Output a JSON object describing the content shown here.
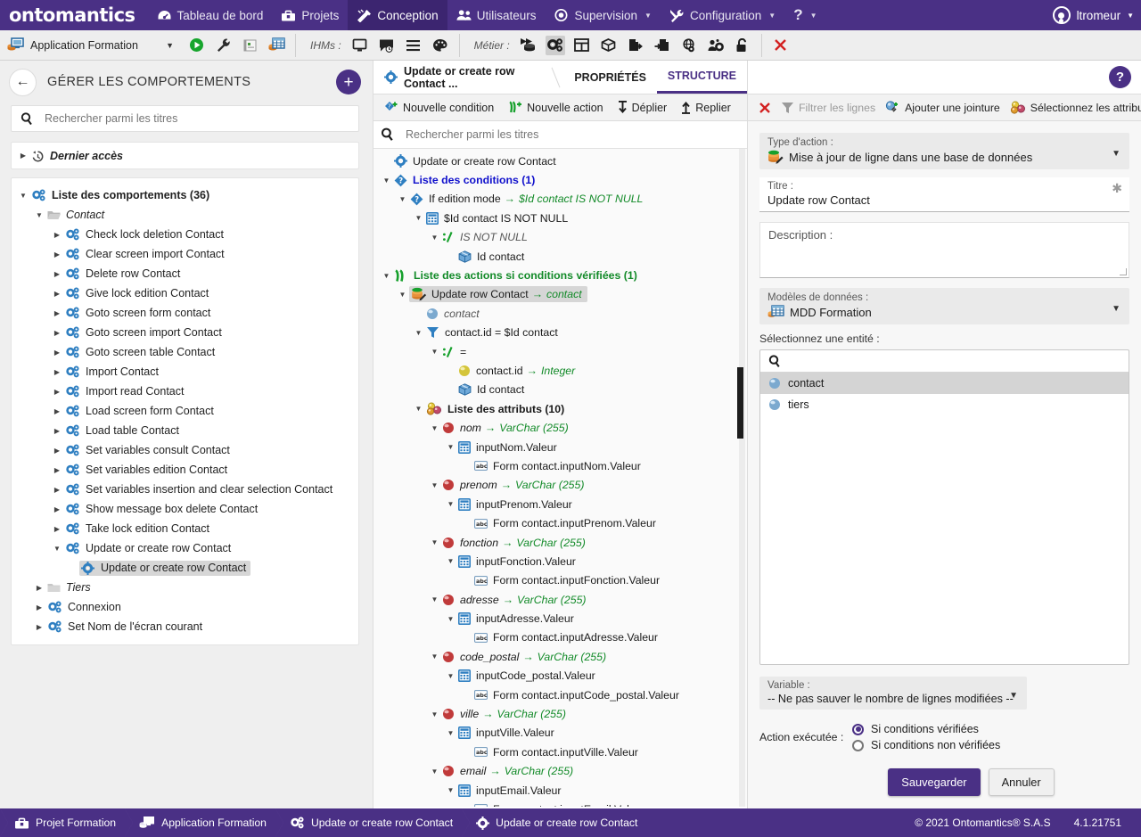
{
  "topnav": {
    "brand": "ontomantics",
    "items": [
      {
        "label": "Tableau de bord",
        "icon": "dashboard-icon",
        "caret": false,
        "active": false
      },
      {
        "label": "Projets",
        "icon": "toolbox-icon",
        "caret": false,
        "active": false
      },
      {
        "label": "Conception",
        "icon": "design-icon",
        "caret": false,
        "active": true
      },
      {
        "label": "Utilisateurs",
        "icon": "users-icon",
        "caret": false,
        "active": false
      },
      {
        "label": "Supervision",
        "icon": "eye-icon",
        "caret": true,
        "active": false
      },
      {
        "label": "Configuration",
        "icon": "tools-icon",
        "caret": true,
        "active": false
      },
      {
        "label": "?",
        "icon": "help-icon",
        "caret": true,
        "active": false
      }
    ],
    "user": "ltromeur"
  },
  "toolbar2": {
    "app_name": "Application Formation",
    "app_icon": "database-screen-icon",
    "dropdown_caret": "▼",
    "actions": [
      {
        "icon": "play-icon",
        "name": "run-button"
      },
      {
        "icon": "wrench-icon",
        "name": "tools-button"
      },
      {
        "icon": "report-icon",
        "name": "report-button"
      },
      {
        "icon": "db-table-icon",
        "name": "database-button"
      }
    ],
    "ihms_label": "IHMs :",
    "ihms_icons": [
      {
        "icon": "screen-icon",
        "name": "screens-button"
      },
      {
        "icon": "message-box-icon",
        "name": "messagebox-button"
      },
      {
        "icon": "menu-icon",
        "name": "menu-button"
      },
      {
        "icon": "palette-icon",
        "name": "theme-button"
      }
    ],
    "metier_label": "Métier :",
    "metier_icons": [
      {
        "icon": "dataflow-icon",
        "name": "dataflow-button",
        "selected": false
      },
      {
        "icon": "behaviors-icon",
        "name": "behaviors-button",
        "selected": true
      },
      {
        "icon": "grid-icon",
        "name": "grid-button",
        "selected": false
      },
      {
        "icon": "package-icon",
        "name": "package-button",
        "selected": false
      },
      {
        "icon": "export-icon",
        "name": "export-button",
        "selected": false
      },
      {
        "icon": "import-icon",
        "name": "import-button",
        "selected": false
      },
      {
        "icon": "webservice-icon",
        "name": "webservice-button",
        "selected": false
      },
      {
        "icon": "usergroup-gear-icon",
        "name": "roles-button",
        "selected": false
      },
      {
        "icon": "unlock-icon",
        "name": "unlock-button",
        "selected": false
      }
    ],
    "close_icon": "close-icon"
  },
  "left_panel": {
    "title": "GÉRER LES COMPORTEMENTS",
    "back_icon": "arrow-left-icon",
    "add_label": "+",
    "search_placeholder": "Rechercher parmi les titres",
    "search_value": "",
    "recent_label": "Dernier accès",
    "recent_icon": "history-icon",
    "root_label": "Liste des comportements (36)",
    "folder_contact": "Contact",
    "contact_items": [
      "Check lock deletion Contact",
      "Clear screen import Contact",
      "Delete row Contact",
      "Give lock edition Contact",
      "Goto screen form contact",
      "Goto screen import Contact",
      "Goto screen table Contact",
      "Import Contact",
      "Import read Contact",
      "Load screen form Contact",
      "Load table Contact",
      "Set variables consult Contact",
      "Set variables edition Contact",
      "Set variables insertion and clear selection Contact",
      "Show message box delete Contact",
      "Take lock edition Contact"
    ],
    "expanded_item": "Update or create row Contact",
    "selected_child": "Update or create row Contact",
    "folder_tiers": "Tiers",
    "tail_items": [
      "Connexion",
      "Set Nom de l'écran courant"
    ]
  },
  "mid_panel": {
    "tabs": [
      {
        "label": "Update or create row Contact ...",
        "icon": "gear-icon",
        "active": false,
        "node": true
      },
      {
        "label": "PROPRIÉTÉS",
        "active": false,
        "node": false
      },
      {
        "label": "STRUCTURE",
        "active": true,
        "node": false
      }
    ],
    "toolbar": [
      {
        "label": "Nouvelle condition",
        "icon": "new-condition-icon"
      },
      {
        "label": "Nouvelle action",
        "icon": "new-action-icon"
      },
      {
        "label": "Déplier",
        "icon": "expand-icon"
      },
      {
        "label": "Replier",
        "icon": "collapse-icon"
      }
    ],
    "search_placeholder": "Rechercher parmi les titres",
    "search_value": "",
    "tree": [
      {
        "indent": 0,
        "tw": "none",
        "icon": "gear-icon",
        "text": "Update or create row Contact",
        "style": "plain"
      },
      {
        "indent": 0,
        "tw": "open",
        "icon": "condition-icon",
        "text": "Liste des conditions (1)",
        "style": "blue-bold"
      },
      {
        "indent": 1,
        "tw": "open",
        "icon": "condition-icon",
        "text": "If edition mode",
        "arrow": "→",
        "suffix": "$Id contact IS NOT NULL",
        "style": "plain-green-it"
      },
      {
        "indent": 2,
        "tw": "open",
        "icon": "calc-icon",
        "text": "$Id contact IS NOT NULL",
        "style": "plain"
      },
      {
        "indent": 3,
        "tw": "open",
        "icon": "operator-icon",
        "text": "IS NOT NULL",
        "style": "gray-it"
      },
      {
        "indent": 4,
        "tw": "none",
        "icon": "box-icon",
        "text": "Id contact",
        "style": "plain"
      },
      {
        "indent": 0,
        "tw": "open",
        "icon": "actions-icon",
        "text": "Liste des actions si conditions vérifiées (1)",
        "style": "green-bold"
      },
      {
        "indent": 1,
        "tw": "open",
        "icon": "update-row-icon",
        "text": "Update row Contact",
        "arrow": "→",
        "suffix": "contact",
        "style": "selected-green-it"
      },
      {
        "indent": 2,
        "tw": "none",
        "icon": "entity-icon",
        "text": "contact",
        "style": "gray-it"
      },
      {
        "indent": 2,
        "tw": "open",
        "icon": "filter-icon",
        "text": "contact.id = $Id contact",
        "style": "plain"
      },
      {
        "indent": 3,
        "tw": "open",
        "icon": "operator-icon",
        "text": "=",
        "style": "plain"
      },
      {
        "indent": 4,
        "tw": "none",
        "icon": "yellow-ball-icon",
        "text": "contact.id",
        "arrow": "→",
        "suffix": "Integer",
        "style": "plain-green-it"
      },
      {
        "indent": 4,
        "tw": "none",
        "icon": "box-icon",
        "text": "Id contact",
        "style": "plain"
      },
      {
        "indent": 2,
        "tw": "open",
        "icon": "attributes-icon",
        "text": "Liste des attributs (10)",
        "style": "bold"
      },
      {
        "indent": 3,
        "tw": "open",
        "icon": "red-ball-icon",
        "text": "nom",
        "arrow": "→",
        "suffix": "VarChar (255)",
        "style": "it-green-it"
      },
      {
        "indent": 4,
        "tw": "open",
        "icon": "calc-icon",
        "text": "inputNom.Valeur",
        "style": "plain"
      },
      {
        "indent": 5,
        "tw": "none",
        "icon": "abc-icon",
        "text": "Form contact.inputNom.Valeur",
        "style": "plain"
      },
      {
        "indent": 3,
        "tw": "open",
        "icon": "red-ball-icon",
        "text": "prenom",
        "arrow": "→",
        "suffix": "VarChar (255)",
        "style": "it-green-it"
      },
      {
        "indent": 4,
        "tw": "open",
        "icon": "calc-icon",
        "text": "inputPrenom.Valeur",
        "style": "plain"
      },
      {
        "indent": 5,
        "tw": "none",
        "icon": "abc-icon",
        "text": "Form contact.inputPrenom.Valeur",
        "style": "plain"
      },
      {
        "indent": 3,
        "tw": "open",
        "icon": "red-ball-icon",
        "text": "fonction",
        "arrow": "→",
        "suffix": "VarChar (255)",
        "style": "it-green-it"
      },
      {
        "indent": 4,
        "tw": "open",
        "icon": "calc-icon",
        "text": "inputFonction.Valeur",
        "style": "plain"
      },
      {
        "indent": 5,
        "tw": "none",
        "icon": "abc-icon",
        "text": "Form contact.inputFonction.Valeur",
        "style": "plain"
      },
      {
        "indent": 3,
        "tw": "open",
        "icon": "red-ball-icon",
        "text": "adresse",
        "arrow": "→",
        "suffix": "VarChar (255)",
        "style": "it-green-it"
      },
      {
        "indent": 4,
        "tw": "open",
        "icon": "calc-icon",
        "text": "inputAdresse.Valeur",
        "style": "plain"
      },
      {
        "indent": 5,
        "tw": "none",
        "icon": "abc-icon",
        "text": "Form contact.inputAdresse.Valeur",
        "style": "plain"
      },
      {
        "indent": 3,
        "tw": "open",
        "icon": "red-ball-icon",
        "text": "code_postal",
        "arrow": "→",
        "suffix": "VarChar (255)",
        "style": "it-green-it"
      },
      {
        "indent": 4,
        "tw": "open",
        "icon": "calc-icon",
        "text": "inputCode_postal.Valeur",
        "style": "plain"
      },
      {
        "indent": 5,
        "tw": "none",
        "icon": "abc-icon",
        "text": "Form contact.inputCode_postal.Valeur",
        "style": "plain"
      },
      {
        "indent": 3,
        "tw": "open",
        "icon": "red-ball-icon",
        "text": "ville",
        "arrow": "→",
        "suffix": "VarChar (255)",
        "style": "it-green-it"
      },
      {
        "indent": 4,
        "tw": "open",
        "icon": "calc-icon",
        "text": "inputVille.Valeur",
        "style": "plain"
      },
      {
        "indent": 5,
        "tw": "none",
        "icon": "abc-icon",
        "text": "Form contact.inputVille.Valeur",
        "style": "plain"
      },
      {
        "indent": 3,
        "tw": "open",
        "icon": "red-ball-icon",
        "text": "email",
        "arrow": "→",
        "suffix": "VarChar (255)",
        "style": "it-green-it"
      },
      {
        "indent": 4,
        "tw": "open",
        "icon": "calc-icon",
        "text": "inputEmail.Valeur",
        "style": "plain"
      },
      {
        "indent": 5,
        "tw": "none",
        "icon": "abc-icon",
        "text": "Form contact.inputEmail.Valeur",
        "style": "plain"
      }
    ]
  },
  "right_panel": {
    "help_label": "?",
    "toolbar": [
      {
        "label": "",
        "icon": "close-icon",
        "dim": false
      },
      {
        "label": "Filtrer les lignes",
        "icon": "filter-icon",
        "dim": true
      },
      {
        "label": "Ajouter une jointure",
        "icon": "join-icon",
        "dim": false
      },
      {
        "label": "Sélectionnez les attributs",
        "icon": "attributes-icon",
        "dim": false
      }
    ],
    "action_type_label": "Type d'action :",
    "action_type_value": "Mise à jour de ligne dans une base de données",
    "action_type_icon": "update-row-icon",
    "title_label": "Titre :",
    "title_value": "Update row Contact",
    "title_required_marker": "✱",
    "description_label": "Description :",
    "description_value": "",
    "datamodel_label": "Modèles de données :",
    "datamodel_value": "MDD Formation",
    "datamodel_icon": "db-table-icon",
    "entity_label": "Sélectionnez une entité :",
    "entity_search_value": "",
    "entities": [
      {
        "label": "contact",
        "selected": true
      },
      {
        "label": "tiers",
        "selected": false
      }
    ],
    "variable_label": "Variable :",
    "variable_value": "-- Ne pas sauver le nombre de lignes modifiées --",
    "exec_label": "Action exécutée :",
    "exec_options": [
      {
        "label": "Si conditions vérifiées",
        "checked": true
      },
      {
        "label": "Si conditions non vérifiées",
        "checked": false
      }
    ],
    "save_label": "Sauvegarder",
    "cancel_label": "Annuler"
  },
  "statusbar": {
    "crumbs": [
      {
        "label": "Projet Formation",
        "icon": "toolbox-icon"
      },
      {
        "label": "Application Formation",
        "icon": "database-screen-icon"
      },
      {
        "label": "Update or create row Contact",
        "icon": "gears-icon"
      },
      {
        "label": "Update or create row Contact",
        "icon": "gear-icon"
      }
    ],
    "copyright": "© 2021 Ontomantics® S.A.S",
    "version": "4.1.21751"
  },
  "colors": {
    "brand_purple": "#4a3085",
    "accent_blue": "#1111cc",
    "accent_green": "#128a28",
    "toolbar_gray": "#eeeeee"
  }
}
